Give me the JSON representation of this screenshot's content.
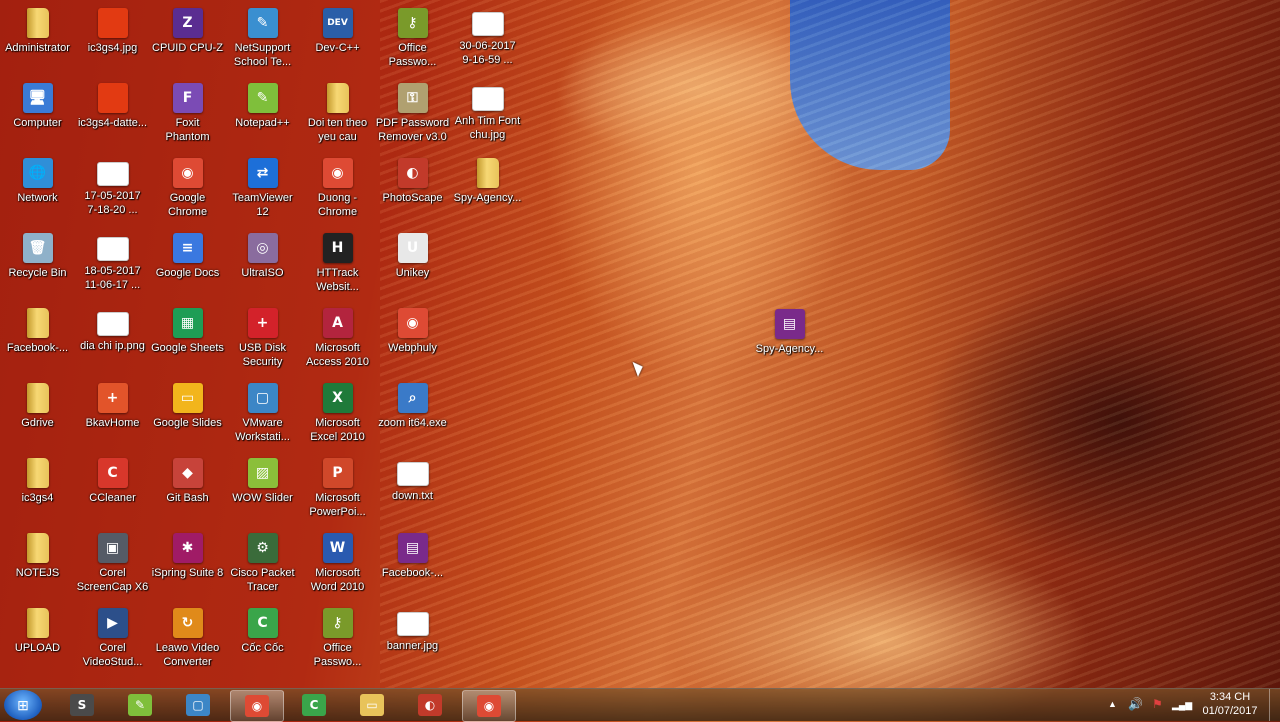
{
  "desktop": {
    "icons": [
      {
        "label": "Administrator",
        "icon": "folder-icon",
        "kind": "folder",
        "color": "#e8c35a"
      },
      {
        "label": "Computer",
        "icon": "computer-icon",
        "kind": "glyph",
        "glyph": "🖥",
        "color": "#3b7bd6"
      },
      {
        "label": "Network",
        "icon": "network-icon",
        "kind": "glyph",
        "glyph": "🌐",
        "color": "#2f8fd8"
      },
      {
        "label": "Recycle Bin",
        "icon": "recycle-bin-icon",
        "kind": "glyph",
        "glyph": "🗑",
        "color": "#8fb1c9"
      },
      {
        "label": "Facebook-...",
        "icon": "folder-icon",
        "kind": "folder",
        "color": "#e8c35a"
      },
      {
        "label": "Gdrive",
        "icon": "folder-icon",
        "kind": "folder",
        "color": "#e8c35a"
      },
      {
        "label": "ic3gs4",
        "icon": "folder-icon",
        "kind": "folder",
        "color": "#e8c35a"
      },
      {
        "label": "NOTEJS",
        "icon": "folder-icon",
        "kind": "folder",
        "color": "#e8c35a"
      },
      {
        "label": "UPLOAD",
        "icon": "folder-icon",
        "kind": "folder",
        "color": "#e8c35a"
      },
      {
        "label": "ic3gs4.jpg",
        "icon": "image-file-icon",
        "kind": "glyph",
        "glyph": "",
        "color": "#e23a12"
      },
      {
        "label": "ic3gs4-datte...",
        "icon": "image-file-icon",
        "kind": "glyph",
        "glyph": "",
        "color": "#e23a12"
      },
      {
        "label": "17-05-2017\n7-18-20 ...",
        "icon": "image-file-icon",
        "kind": "image",
        "glyph": "",
        "color": "#ffffff"
      },
      {
        "label": "18-05-2017\n11-06-17 ...",
        "icon": "image-file-icon",
        "kind": "image",
        "glyph": "",
        "color": "#ffffff"
      },
      {
        "label": "dia chi ip.png",
        "icon": "image-file-icon",
        "kind": "image",
        "glyph": "",
        "color": "#ffffff"
      },
      {
        "label": "BkavHome",
        "icon": "bkav-shield-icon",
        "kind": "glyph",
        "glyph": "+",
        "color": "#e2542a"
      },
      {
        "label": "CCleaner",
        "icon": "ccleaner-icon",
        "kind": "glyph",
        "glyph": "C",
        "color": "#d8372b"
      },
      {
        "label": "Corel\nScreenCap X6",
        "icon": "screencap-icon",
        "kind": "glyph",
        "glyph": "▣",
        "color": "#555b66"
      },
      {
        "label": "Corel\nVideoStud...",
        "icon": "videostudio-icon",
        "kind": "glyph",
        "glyph": "▶",
        "color": "#2c4f8a"
      },
      {
        "label": "CPUID CPU-Z",
        "icon": "cpu-z-icon",
        "kind": "glyph",
        "glyph": "Z",
        "color": "#5a2d91"
      },
      {
        "label": "Foxit\nPhantom",
        "icon": "foxit-icon",
        "kind": "glyph",
        "glyph": "F",
        "color": "#7b4bb5"
      },
      {
        "label": "Google\nChrome",
        "icon": "chrome-icon",
        "kind": "glyph",
        "glyph": "◉",
        "color": "#de4a34"
      },
      {
        "label": "Google Docs",
        "icon": "google-docs-icon",
        "kind": "glyph",
        "glyph": "≡",
        "color": "#3a78e0"
      },
      {
        "label": "Google Sheets",
        "icon": "google-sheets-icon",
        "kind": "glyph",
        "glyph": "▦",
        "color": "#1e9d55"
      },
      {
        "label": "Google Slides",
        "icon": "google-slides-icon",
        "kind": "glyph",
        "glyph": "▭",
        "color": "#f2b51c"
      },
      {
        "label": "Git Bash",
        "icon": "git-bash-icon",
        "kind": "glyph",
        "glyph": "◆",
        "color": "#c7433a"
      },
      {
        "label": "iSpring Suite 8",
        "icon": "ispring-icon",
        "kind": "glyph",
        "glyph": "✱",
        "color": "#a01b66"
      },
      {
        "label": "Leawo Video\nConverter",
        "icon": "leawo-icon",
        "kind": "glyph",
        "glyph": "↻",
        "color": "#e08a1a"
      },
      {
        "label": "NetSupport\nSchool Te...",
        "icon": "netsupport-icon",
        "kind": "glyph",
        "glyph": "✎",
        "color": "#3a8fd0"
      },
      {
        "label": "Notepad++",
        "icon": "notepad-plus-icon",
        "kind": "glyph",
        "glyph": "✎",
        "color": "#7fbf3b"
      },
      {
        "label": "TeamViewer\n12",
        "icon": "teamviewer-icon",
        "kind": "glyph",
        "glyph": "⇄",
        "color": "#1d6fd8"
      },
      {
        "label": "UltraISO",
        "icon": "ultraiso-icon",
        "kind": "glyph",
        "glyph": "◎",
        "color": "#8a6c9e"
      },
      {
        "label": "USB Disk\nSecurity",
        "icon": "usb-security-icon",
        "kind": "glyph",
        "glyph": "+",
        "color": "#d3222a"
      },
      {
        "label": "VMware\nWorkstati...",
        "icon": "vmware-icon",
        "kind": "glyph",
        "glyph": "▢",
        "color": "#3c86c6"
      },
      {
        "label": "WOW Slider",
        "icon": "wow-slider-icon",
        "kind": "glyph",
        "glyph": "▨",
        "color": "#8bbf3a"
      },
      {
        "label": "Cisco Packet\nTracer",
        "icon": "packet-tracer-icon",
        "kind": "glyph",
        "glyph": "⚙",
        "color": "#3a6b3a"
      },
      {
        "label": "Cốc Cốc",
        "icon": "coccoc-icon",
        "kind": "glyph",
        "glyph": "C",
        "color": "#3aa54a"
      },
      {
        "label": "Dev-C++",
        "icon": "devcpp-icon",
        "kind": "glyph",
        "glyph": "DEV",
        "color": "#2a5ea8"
      },
      {
        "label": "Doi ten theo\nyeu cau",
        "icon": "folder-icon",
        "kind": "folder",
        "color": "#e8c35a"
      },
      {
        "label": "Duong -\nChrome",
        "icon": "chrome-icon",
        "kind": "glyph",
        "glyph": "◉",
        "color": "#de4a34"
      },
      {
        "label": "HTTrack\nWebsit...",
        "icon": "httrack-icon",
        "kind": "glyph",
        "glyph": "H",
        "color": "#222222"
      },
      {
        "label": "Microsoft\nAccess 2010",
        "icon": "ms-access-icon",
        "kind": "glyph",
        "glyph": "A",
        "color": "#b3243e"
      },
      {
        "label": "Microsoft\nExcel 2010",
        "icon": "ms-excel-icon",
        "kind": "glyph",
        "glyph": "X",
        "color": "#1f7a3a"
      },
      {
        "label": "Microsoft\nPowerPoi...",
        "icon": "ms-powerpoint-icon",
        "kind": "glyph",
        "glyph": "P",
        "color": "#d0482a"
      },
      {
        "label": "Microsoft\nWord 2010",
        "icon": "ms-word-icon",
        "kind": "glyph",
        "glyph": "W",
        "color": "#2a5ab0"
      },
      {
        "label": "Office\nPasswo...",
        "icon": "office-password-icon",
        "kind": "glyph",
        "glyph": "⚷",
        "color": "#7a9a2a"
      },
      {
        "label": "Office\nPasswo...",
        "icon": "office-password-icon",
        "kind": "glyph",
        "glyph": "⚷",
        "color": "#7a9a2a"
      },
      {
        "label": "PDF Password\nRemover v3.0",
        "icon": "pdf-password-icon",
        "kind": "glyph",
        "glyph": "⚿",
        "color": "#b0a070"
      },
      {
        "label": "PhotoScape",
        "icon": "photoscape-icon",
        "kind": "glyph",
        "glyph": "◐",
        "color": "#c23a2a"
      },
      {
        "label": "Unikey",
        "icon": "unikey-icon",
        "kind": "glyph",
        "glyph": "U",
        "color": "#e8e8e8"
      },
      {
        "label": "Webphuly",
        "icon": "chrome-icon",
        "kind": "glyph",
        "glyph": "◉",
        "color": "#de4a34"
      },
      {
        "label": "zoom it64.exe",
        "icon": "zoomit-icon",
        "kind": "glyph",
        "glyph": "⌕",
        "color": "#3a7ac8"
      },
      {
        "label": "down.txt",
        "icon": "text-file-icon",
        "kind": "image",
        "glyph": "",
        "color": "#ffffff"
      },
      {
        "label": "Facebook-...",
        "icon": "winrar-icon",
        "kind": "glyph",
        "glyph": "▤",
        "color": "#7a2a8a"
      },
      {
        "label": "banner.jpg",
        "icon": "image-file-icon",
        "kind": "image",
        "glyph": "",
        "color": "#ffffff"
      },
      {
        "label": "30-06-2017\n9-16-59 ...",
        "icon": "image-file-icon",
        "kind": "image",
        "glyph": "",
        "color": "#ffffff"
      },
      {
        "label": "Anh Tim Font\nchu.jpg",
        "icon": "image-file-icon",
        "kind": "image",
        "glyph": "",
        "color": "#ffffff"
      },
      {
        "label": "Spy-Agency...",
        "icon": "folder-icon",
        "kind": "folder",
        "color": "#e8c35a"
      },
      {
        "label": "Spy-Agency...",
        "icon": "winrar-icon",
        "kind": "glyph",
        "glyph": "▤",
        "color": "#7a2a8a"
      }
    ]
  },
  "taskbar": {
    "start_label": "⊞",
    "pinned": [
      {
        "name": "sublime",
        "icon": "sublime-text-icon",
        "glyph": "S",
        "color": "#4a4a4a",
        "active": false
      },
      {
        "name": "notepad",
        "icon": "notepad-plus-icon",
        "glyph": "✎",
        "color": "#7fbf3b",
        "active": false
      },
      {
        "name": "vmware",
        "icon": "vmware-icon",
        "glyph": "▢",
        "color": "#3c86c6",
        "active": false
      },
      {
        "name": "chrome",
        "icon": "chrome-icon",
        "glyph": "◉",
        "color": "#de4a34",
        "active": true
      },
      {
        "name": "coccoc",
        "icon": "coccoc-icon",
        "glyph": "C",
        "color": "#3aa54a",
        "active": false
      },
      {
        "name": "explorer",
        "icon": "file-explorer-icon",
        "glyph": "▭",
        "color": "#e8c35a",
        "active": false
      },
      {
        "name": "photoscape",
        "icon": "photoscape-icon",
        "glyph": "◐",
        "color": "#c23a2a",
        "active": false
      },
      {
        "name": "chrome2",
        "icon": "chrome-icon",
        "glyph": "◉",
        "color": "#de4a34",
        "active": true
      }
    ],
    "tray": {
      "up_arrow": "▲",
      "volume": "🔊",
      "flag": "⚑",
      "network": "▂▄▆"
    },
    "clock": {
      "time": "3:34 CH",
      "date": "01/07/2017"
    }
  }
}
